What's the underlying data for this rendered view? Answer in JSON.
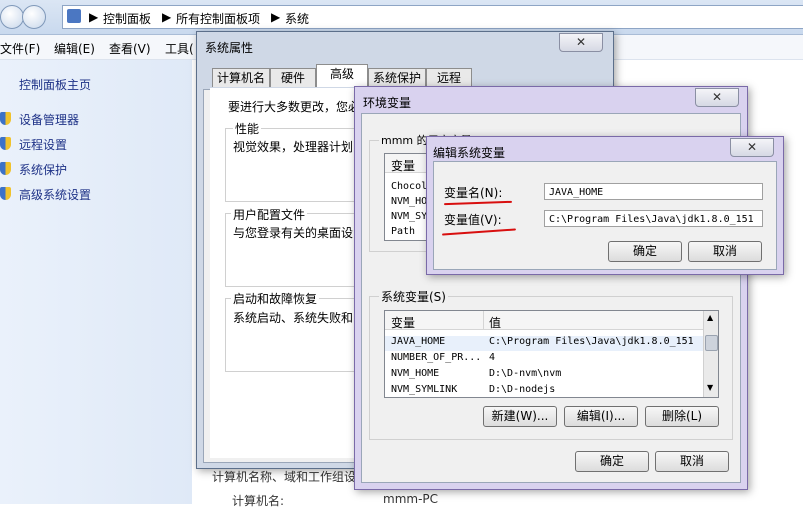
{
  "explorer": {
    "breadcrumb": [
      "控制面板",
      "所有控制面板项",
      "系统"
    ],
    "menu": [
      "文件(F)",
      "编辑(E)",
      "查看(V)",
      "工具("
    ],
    "sidebar_home": "控制面板主页",
    "tasks": [
      "设备管理器",
      "远程设置",
      "系统保护",
      "高级系统设置"
    ],
    "bottom_text": "计算机名称、域和工作组设",
    "bottom_label": "计算机名:",
    "bottom_value": "mmm-PC"
  },
  "sysprops": {
    "title": "系统属性",
    "close": "✕",
    "tabs": [
      "计算机名",
      "硬件",
      "高级",
      "系统保护",
      "远程"
    ],
    "intro": "要进行大多数更改，您必",
    "perf_title": "性能",
    "perf_desc": "视觉效果，处理器计划",
    "profile_title": "用户配置文件",
    "profile_desc": "与您登录有关的桌面设",
    "startup_title": "启动和故障恢复",
    "startup_desc": "系统启动、系统失败和"
  },
  "envvars": {
    "title": "环境变量",
    "close": "✕",
    "user_label": "mmm 的用户变量(U)",
    "user_header": [
      "变量",
      "值"
    ],
    "user_rows": [
      "Chocol",
      "NVM_HO",
      "NVM_SY",
      "Path"
    ],
    "sys_label": "系统变量(S)",
    "sys_header": [
      "变量",
      "值"
    ],
    "sys_rows": [
      {
        "name": "JAVA_HOME",
        "value": "C:\\Program Files\\Java\\jdk1.8.0_151"
      },
      {
        "name": "NUMBER_OF_PR...",
        "value": "4"
      },
      {
        "name": "NVM_HOME",
        "value": "D:\\D-nvm\\nvm"
      },
      {
        "name": "NVM_SYMLINK",
        "value": "D:\\D-nodejs"
      }
    ],
    "new_button": "新建(W)...",
    "edit_button": "编辑(I)...",
    "delete_button": "删除(L)",
    "ok_button": "确定",
    "cancel_button": "取消"
  },
  "editvar": {
    "title": "编辑系统变量",
    "close": "✕",
    "name_label": "变量名(N):",
    "name_value": "JAVA_HOME",
    "value_label": "变量值(V):",
    "value_value": "C:\\Program Files\\Java\\jdk1.8.0_151",
    "ok_button": "确定",
    "cancel_button": "取消"
  },
  "colors": {
    "annotation": "#d80f0f",
    "link": "#1e3287"
  }
}
